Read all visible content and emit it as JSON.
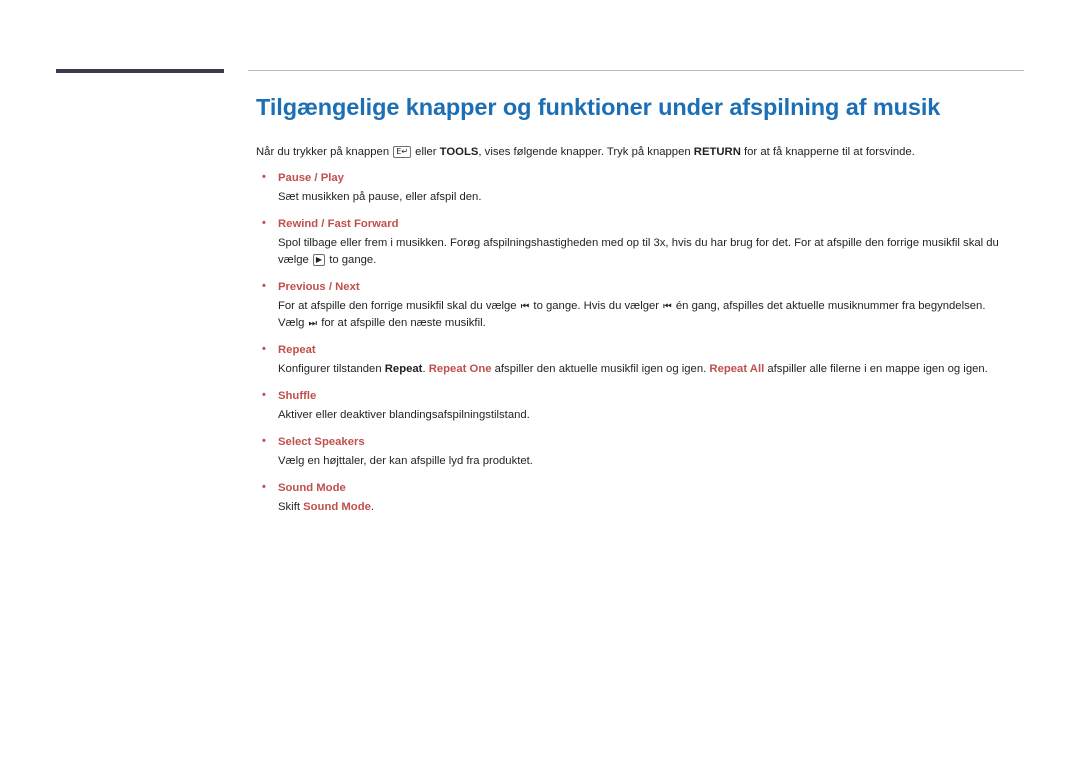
{
  "page": {
    "title": "Tilgængelige knapper og funktioner under afspilning af musik",
    "intro": {
      "prefix": "Når du trykker på knappen",
      "enter_key_glyph": "E↵",
      "mid1": "eller",
      "tools_label": "TOOLS",
      "mid2": ", vises følgende knapper. Tryk på knappen",
      "return_label": "RETURN",
      "suffix": "for at få knapperne til at forsvinde."
    },
    "items": [
      {
        "heading": "Pause / Play",
        "body_parts": [
          {
            "type": "text",
            "value": "Sæt musikken på pause, eller afspil den."
          }
        ]
      },
      {
        "heading": "Rewind / Fast Forward",
        "body_parts": [
          {
            "type": "text",
            "value": "Spol tilbage eller frem i musikken. Forøg afspilningshastigheden med op til 3x, hvis du har brug for det. For at afspille den forrige musikfil skal du vælge "
          },
          {
            "type": "key",
            "value": "▶"
          },
          {
            "type": "text",
            "value": " to gange."
          }
        ]
      },
      {
        "heading": "Previous / Next",
        "body_parts": [
          {
            "type": "text",
            "value": "For at afspille den forrige musikfil skal du vælge "
          },
          {
            "type": "glyph",
            "value": "⏮"
          },
          {
            "type": "text",
            "value": " to gange. Hvis du vælger "
          },
          {
            "type": "glyph",
            "value": "⏮"
          },
          {
            "type": "text",
            "value": " én gang, afspilles det aktuelle musiknummer fra begyndelsen."
          },
          {
            "type": "break"
          },
          {
            "type": "text",
            "value": "Vælg "
          },
          {
            "type": "glyph",
            "value": "⏭"
          },
          {
            "type": "text",
            "value": " for at afspille den næste musikfil."
          }
        ]
      },
      {
        "heading": "Repeat",
        "body_parts": [
          {
            "type": "text",
            "value": "Konfigurer tilstanden "
          },
          {
            "type": "bold",
            "value": "Repeat"
          },
          {
            "type": "text",
            "value": ". "
          },
          {
            "type": "hl",
            "value": "Repeat One"
          },
          {
            "type": "text",
            "value": " afspiller den aktuelle musikfil igen og igen. "
          },
          {
            "type": "hl",
            "value": "Repeat All"
          },
          {
            "type": "text",
            "value": " afspiller alle filerne i en mappe igen og igen."
          }
        ]
      },
      {
        "heading": "Shuffle",
        "body_parts": [
          {
            "type": "text",
            "value": "Aktiver eller deaktiver blandingsafspilningstilstand."
          }
        ]
      },
      {
        "heading": "Select Speakers",
        "body_parts": [
          {
            "type": "text",
            "value": "Vælg en højttaler, der kan afspille lyd fra produktet."
          }
        ]
      },
      {
        "heading": "Sound Mode",
        "body_parts": [
          {
            "type": "text",
            "value": "Skift "
          },
          {
            "type": "hl",
            "value": "Sound Mode"
          },
          {
            "type": "text",
            "value": "."
          }
        ]
      }
    ]
  },
  "colors": {
    "title": "#1c6fb5",
    "heading": "#c0504d",
    "rule_dark": "#3b3b4f",
    "rule_light": "#b9bcbe",
    "text": "#231f20"
  }
}
